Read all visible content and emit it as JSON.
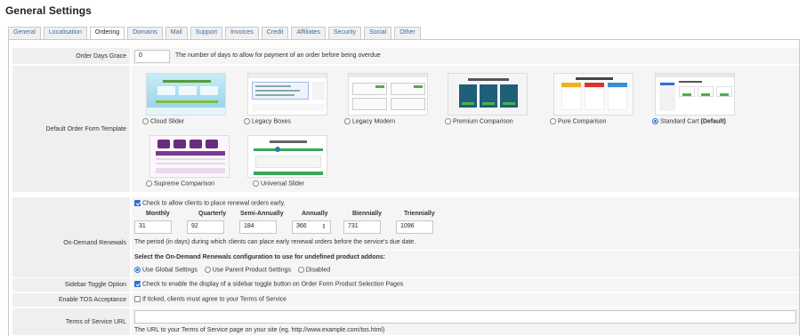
{
  "page_title": "General Settings",
  "tabs": [
    "General",
    "Localisation",
    "Ordering",
    "Domains",
    "Mail",
    "Support",
    "Invoices",
    "Credit",
    "Affiliates",
    "Security",
    "Social",
    "Other"
  ],
  "active_tab": "Ordering",
  "order_days_grace": {
    "label": "Order Days Grace",
    "value": "0",
    "help": "The number of days to allow for payment of an order before being overdue"
  },
  "order_form_template": {
    "label": "Default Order Form Template",
    "templates": [
      {
        "name": "Cloud Slider",
        "selected": false
      },
      {
        "name": "Legacy Boxes",
        "selected": false
      },
      {
        "name": "Legacy Modern",
        "selected": false
      },
      {
        "name": "Premium Comparison",
        "selected": false
      },
      {
        "name": "Pure Comparison",
        "selected": false
      },
      {
        "name": "Standard Cart",
        "suffix": "(Default)",
        "selected": true
      },
      {
        "name": "Supreme Comparison",
        "selected": false
      },
      {
        "name": "Universal Slider",
        "selected": false
      }
    ]
  },
  "on_demand_renewals": {
    "label": "On-Demand Renewals",
    "checkbox_label": "Check to allow clients to place renewal orders early.",
    "checked": true,
    "periods": [
      {
        "name": "Monthly",
        "value": "31"
      },
      {
        "name": "Quarterly",
        "value": "92"
      },
      {
        "name": "Semi-Annually",
        "value": "184"
      },
      {
        "name": "Annually",
        "value": "366"
      },
      {
        "name": "Biennially",
        "value": "731"
      },
      {
        "name": "Triennially",
        "value": "1096"
      }
    ],
    "help": "The period (in days) during which clients can place early renewal orders before the service's due date.",
    "addon_heading": "Select the On-Demand Renewals configuration to use for undefined product addons:",
    "addon_options": [
      {
        "label": "Use Global Settings",
        "selected": true
      },
      {
        "label": "Use Parent Product Settings",
        "selected": false
      },
      {
        "label": "Disabled",
        "selected": false
      }
    ]
  },
  "sidebar_toggle": {
    "label": "Sidebar Toggle Option",
    "checkbox_label": "Check to enable the display of a sidebar toggle button on Order Form Product Selection Pages",
    "checked": true
  },
  "tos_acceptance": {
    "label": "Enable TOS Acceptance",
    "checkbox_label": "If ticked, clients must agree to your Terms of Service",
    "checked": false
  },
  "tos_url": {
    "label": "Terms of Service URL",
    "value": "",
    "help": "The URL to your Terms of Service page on your site (eg. http://www.example.com/tos.html)"
  },
  "colors": {
    "accent": "#2f6fd6",
    "link": "#3a6ea5",
    "label_bg": "#efefef",
    "field_bg": "#f5f5f5"
  }
}
